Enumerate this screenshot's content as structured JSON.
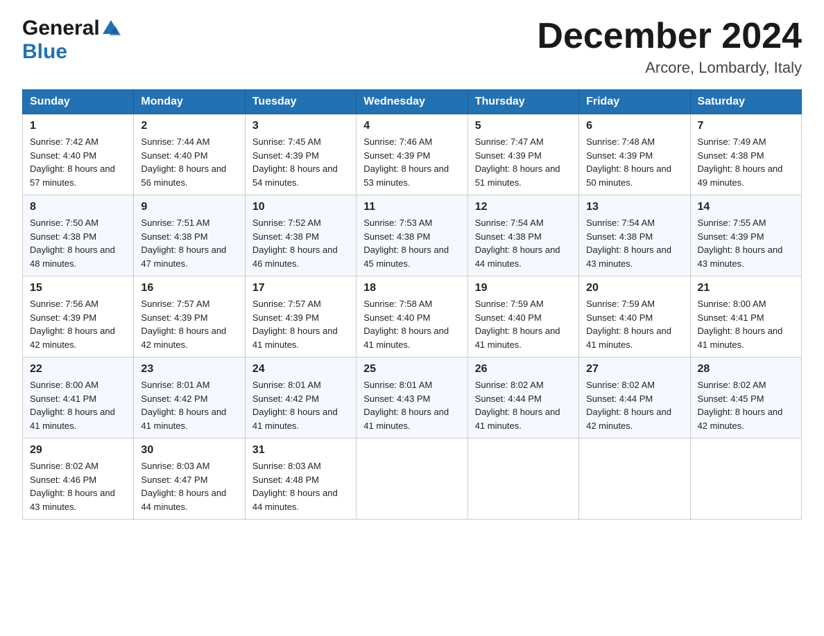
{
  "header": {
    "logo_general": "General",
    "logo_blue": "Blue",
    "month_title": "December 2024",
    "location": "Arcore, Lombardy, Italy"
  },
  "days_of_week": [
    "Sunday",
    "Monday",
    "Tuesday",
    "Wednesday",
    "Thursday",
    "Friday",
    "Saturday"
  ],
  "weeks": [
    [
      {
        "day": "1",
        "sunrise": "7:42 AM",
        "sunset": "4:40 PM",
        "daylight": "8 hours and 57 minutes."
      },
      {
        "day": "2",
        "sunrise": "7:44 AM",
        "sunset": "4:40 PM",
        "daylight": "8 hours and 56 minutes."
      },
      {
        "day": "3",
        "sunrise": "7:45 AM",
        "sunset": "4:39 PM",
        "daylight": "8 hours and 54 minutes."
      },
      {
        "day": "4",
        "sunrise": "7:46 AM",
        "sunset": "4:39 PM",
        "daylight": "8 hours and 53 minutes."
      },
      {
        "day": "5",
        "sunrise": "7:47 AM",
        "sunset": "4:39 PM",
        "daylight": "8 hours and 51 minutes."
      },
      {
        "day": "6",
        "sunrise": "7:48 AM",
        "sunset": "4:39 PM",
        "daylight": "8 hours and 50 minutes."
      },
      {
        "day": "7",
        "sunrise": "7:49 AM",
        "sunset": "4:38 PM",
        "daylight": "8 hours and 49 minutes."
      }
    ],
    [
      {
        "day": "8",
        "sunrise": "7:50 AM",
        "sunset": "4:38 PM",
        "daylight": "8 hours and 48 minutes."
      },
      {
        "day": "9",
        "sunrise": "7:51 AM",
        "sunset": "4:38 PM",
        "daylight": "8 hours and 47 minutes."
      },
      {
        "day": "10",
        "sunrise": "7:52 AM",
        "sunset": "4:38 PM",
        "daylight": "8 hours and 46 minutes."
      },
      {
        "day": "11",
        "sunrise": "7:53 AM",
        "sunset": "4:38 PM",
        "daylight": "8 hours and 45 minutes."
      },
      {
        "day": "12",
        "sunrise": "7:54 AM",
        "sunset": "4:38 PM",
        "daylight": "8 hours and 44 minutes."
      },
      {
        "day": "13",
        "sunrise": "7:54 AM",
        "sunset": "4:38 PM",
        "daylight": "8 hours and 43 minutes."
      },
      {
        "day": "14",
        "sunrise": "7:55 AM",
        "sunset": "4:39 PM",
        "daylight": "8 hours and 43 minutes."
      }
    ],
    [
      {
        "day": "15",
        "sunrise": "7:56 AM",
        "sunset": "4:39 PM",
        "daylight": "8 hours and 42 minutes."
      },
      {
        "day": "16",
        "sunrise": "7:57 AM",
        "sunset": "4:39 PM",
        "daylight": "8 hours and 42 minutes."
      },
      {
        "day": "17",
        "sunrise": "7:57 AM",
        "sunset": "4:39 PM",
        "daylight": "8 hours and 41 minutes."
      },
      {
        "day": "18",
        "sunrise": "7:58 AM",
        "sunset": "4:40 PM",
        "daylight": "8 hours and 41 minutes."
      },
      {
        "day": "19",
        "sunrise": "7:59 AM",
        "sunset": "4:40 PM",
        "daylight": "8 hours and 41 minutes."
      },
      {
        "day": "20",
        "sunrise": "7:59 AM",
        "sunset": "4:40 PM",
        "daylight": "8 hours and 41 minutes."
      },
      {
        "day": "21",
        "sunrise": "8:00 AM",
        "sunset": "4:41 PM",
        "daylight": "8 hours and 41 minutes."
      }
    ],
    [
      {
        "day": "22",
        "sunrise": "8:00 AM",
        "sunset": "4:41 PM",
        "daylight": "8 hours and 41 minutes."
      },
      {
        "day": "23",
        "sunrise": "8:01 AM",
        "sunset": "4:42 PM",
        "daylight": "8 hours and 41 minutes."
      },
      {
        "day": "24",
        "sunrise": "8:01 AM",
        "sunset": "4:42 PM",
        "daylight": "8 hours and 41 minutes."
      },
      {
        "day": "25",
        "sunrise": "8:01 AM",
        "sunset": "4:43 PM",
        "daylight": "8 hours and 41 minutes."
      },
      {
        "day": "26",
        "sunrise": "8:02 AM",
        "sunset": "4:44 PM",
        "daylight": "8 hours and 41 minutes."
      },
      {
        "day": "27",
        "sunrise": "8:02 AM",
        "sunset": "4:44 PM",
        "daylight": "8 hours and 42 minutes."
      },
      {
        "day": "28",
        "sunrise": "8:02 AM",
        "sunset": "4:45 PM",
        "daylight": "8 hours and 42 minutes."
      }
    ],
    [
      {
        "day": "29",
        "sunrise": "8:02 AM",
        "sunset": "4:46 PM",
        "daylight": "8 hours and 43 minutes."
      },
      {
        "day": "30",
        "sunrise": "8:03 AM",
        "sunset": "4:47 PM",
        "daylight": "8 hours and 44 minutes."
      },
      {
        "day": "31",
        "sunrise": "8:03 AM",
        "sunset": "4:48 PM",
        "daylight": "8 hours and 44 minutes."
      },
      null,
      null,
      null,
      null
    ]
  ]
}
